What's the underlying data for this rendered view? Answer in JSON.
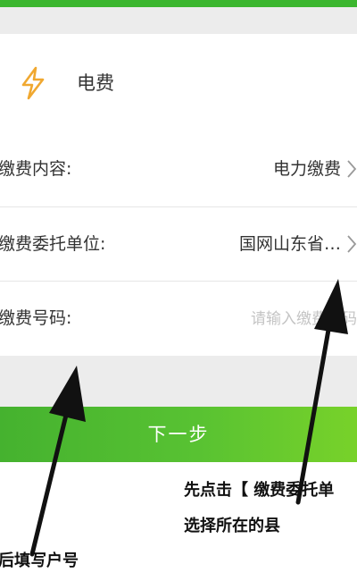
{
  "header": {
    "title": "电费",
    "icon": "lightning-bolt-icon"
  },
  "form": {
    "content_label": "缴费内容:",
    "content_value": "电力缴费",
    "unit_label": "缴费委托单位:",
    "unit_value": "国网山东省…",
    "account_label": "缴费号码:",
    "account_placeholder": "请输入缴费号码"
  },
  "actions": {
    "next_label": "下一步"
  },
  "annotations": {
    "step1_line1": "先点击【 缴费委托单",
    "step1_line2": "选择所在的县",
    "step2": "后填写户号"
  },
  "colors": {
    "accent": "#3bb62e",
    "icon": "#f0a830"
  }
}
